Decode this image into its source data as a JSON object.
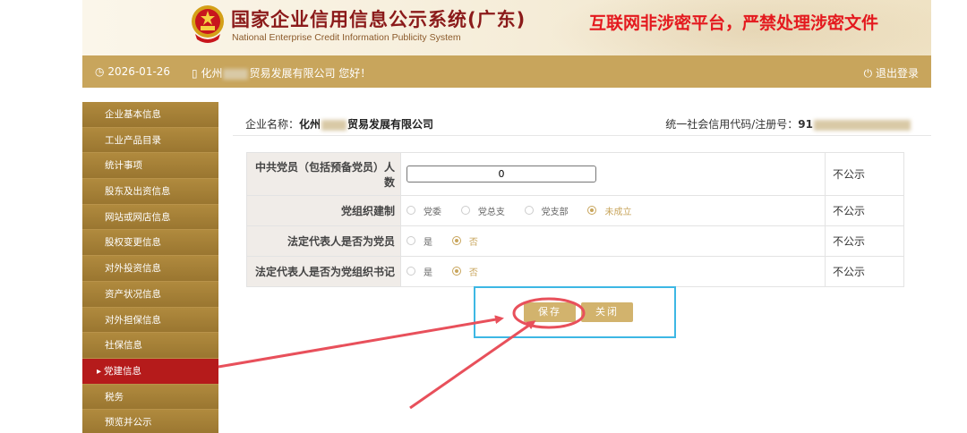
{
  "header": {
    "title_cn": "国家企业信用信息公示系统(广东)",
    "title_en": "National Enterprise Credit Information Publicity System",
    "warning": "互联网非涉密平台，严禁处理涉密文件"
  },
  "topbar": {
    "date": "2026-01-26",
    "welcome_prefix": "化州",
    "welcome_suffix": "贸易发展有限公司 您好！",
    "logout": "退出登录"
  },
  "sidebar": {
    "items": [
      {
        "label": "企业基本信息"
      },
      {
        "label": "工业产品目录"
      },
      {
        "label": "统计事项"
      },
      {
        "label": "股东及出资信息"
      },
      {
        "label": "网站或网店信息"
      },
      {
        "label": "股权变更信息"
      },
      {
        "label": "对外投资信息"
      },
      {
        "label": "资产状况信息"
      },
      {
        "label": "对外担保信息"
      },
      {
        "label": "社保信息"
      },
      {
        "label": "党建信息"
      },
      {
        "label": "税务"
      },
      {
        "label": "预览并公示"
      }
    ],
    "active_index": 10
  },
  "company": {
    "name_label": "企业名称：",
    "name_prefix": "化州",
    "name_suffix": "贸易发展有限公司",
    "code_label": "统一社会信用代码/注册号：",
    "code_prefix": "91"
  },
  "form": {
    "rows": [
      {
        "label": "中共党员（包括预备党员）人数",
        "value": "0",
        "publicity": "不公示"
      },
      {
        "label": "党组织建制",
        "options": [
          "党委",
          "党总支",
          "党支部",
          "未成立"
        ],
        "selected": "未成立",
        "publicity": "不公示"
      },
      {
        "label": "法定代表人是否为党员",
        "options": [
          "是",
          "否"
        ],
        "selected": "否",
        "publicity": "不公示"
      },
      {
        "label": "法定代表人是否为党组织书记",
        "options": [
          "是",
          "否"
        ],
        "selected": "否",
        "publicity": "不公示"
      }
    ]
  },
  "buttons": {
    "save": "保存",
    "close": "关闭"
  },
  "colors": {
    "gold": "#c8a55c",
    "sidebar": "#9a7630",
    "active_red": "#b51b1b",
    "warning_red": "#e4191e",
    "annotation_red": "#e8505b",
    "annotation_blue": "#3db7e4"
  }
}
